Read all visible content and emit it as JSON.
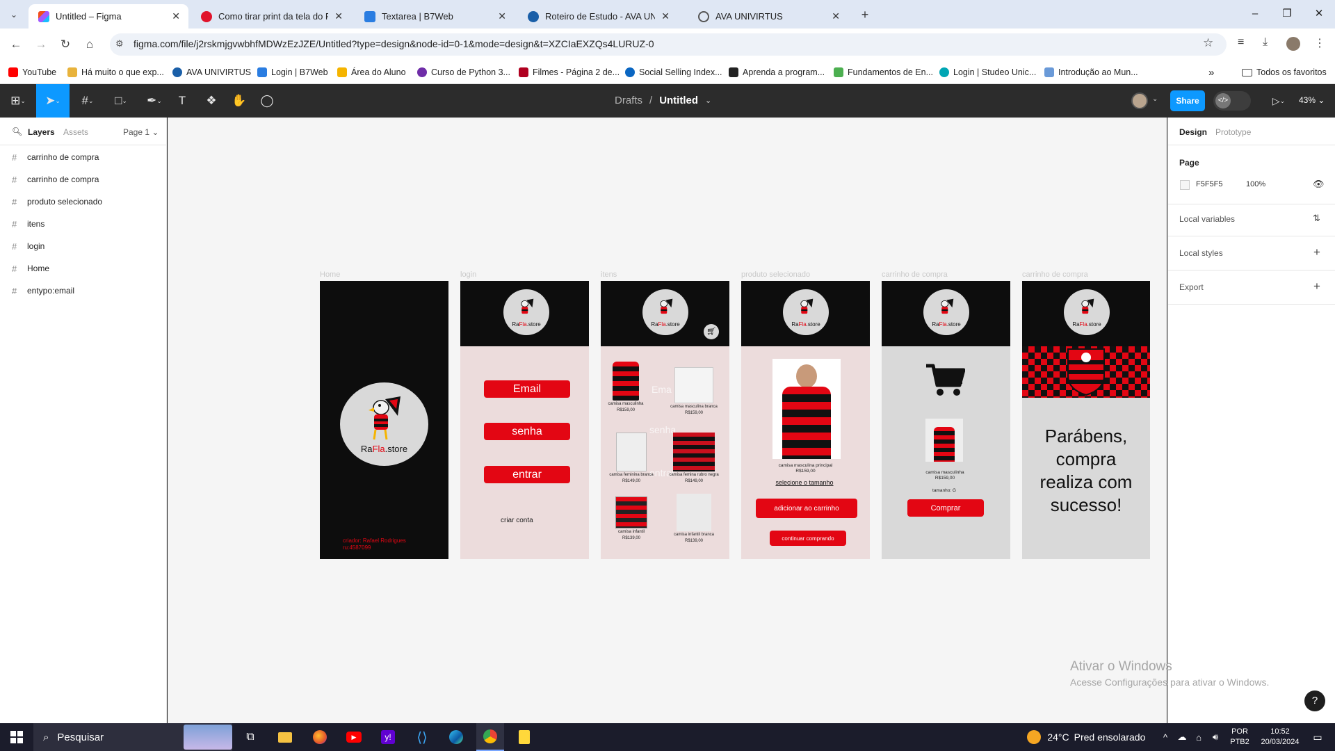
{
  "browser": {
    "tabs": [
      {
        "title": "Untitled – Figma",
        "active": true,
        "icon": "figma-icon"
      },
      {
        "title": "Como tirar print da tela do PC?",
        "active": false,
        "icon": "techtudo-icon"
      },
      {
        "title": "Textarea | B7Web",
        "active": false,
        "icon": "b7web-icon"
      },
      {
        "title": "Roteiro de Estudo - AVA UNIVIRTUS",
        "active": false,
        "icon": "univirtus-icon"
      },
      {
        "title": "AVA UNIVIRTUS",
        "active": false,
        "icon": "globe-icon"
      }
    ],
    "new_tab": "+",
    "url": "figma.com/file/j2rskmjgvwbhfMDWzEzJZE/Untitled?type=design&node-id=0-1&mode=design&t=XZCIaEXZQs4LURUZ-0",
    "bookmarks": [
      {
        "label": "YouTube",
        "color": "#ff0000"
      },
      {
        "label": "Há muito o que exp...",
        "color": "#e8b33c"
      },
      {
        "label": "AVA UNIVIRTUS",
        "color": "#1a5fa8"
      },
      {
        "label": "Login | B7Web",
        "color": "#2a7de1"
      },
      {
        "label": "Área do Aluno",
        "color": "#f5b400"
      },
      {
        "label": "Curso de Python 3...",
        "color": "#6f2da8"
      },
      {
        "label": "Filmes - Página 2 de...",
        "color": "#b00020"
      },
      {
        "label": "Social Selling Index...",
        "color": "#0a66c2"
      },
      {
        "label": "Aprenda a program...",
        "color": "#222222"
      },
      {
        "label": "Fundamentos de En...",
        "color": "#4caf50"
      },
      {
        "label": "Login | Studeo Unic...",
        "color": "#00a6b4"
      },
      {
        "label": "Introdução ao Mun...",
        "color": "#6a9ad8"
      }
    ],
    "favorites_label": "Todos os favoritos"
  },
  "figma": {
    "breadcrumb_drafts": "Drafts",
    "breadcrumb_sep": "/",
    "file_name": "Untitled",
    "share_label": "Share",
    "zoom": "43%",
    "left_tabs": {
      "layers": "Layers",
      "assets": "Assets",
      "page": "Page 1"
    },
    "layers": [
      "carrinho de compra",
      "carrinho de compra",
      "produto selecionado",
      "itens",
      "login",
      "Home",
      "entypo:email"
    ],
    "right_tabs": {
      "design": "Design",
      "prototype": "Prototype"
    },
    "page_section": {
      "title": "Page",
      "color_hex": "F5F5F5",
      "opacity": "100%"
    },
    "sections": [
      "Local variables",
      "Local styles",
      "Export"
    ],
    "accent": "#0d99ff"
  },
  "frames": {
    "labels": [
      "Home",
      "login",
      "itens",
      "produto selecionado",
      "carrinho de compra",
      "carrinho de compra"
    ],
    "logo_text_a": "Ra",
    "logo_text_b": "Fla",
    "logo_text_c": ".store",
    "home": {
      "creator": "criador: Rafael Rodrigues",
      "ru": "ru:4587099"
    },
    "login": {
      "email": "Email",
      "senha": "senha",
      "entrar": "entrar",
      "criar": "criar conta"
    },
    "itens": {
      "ghost_email": "Ema",
      "ghost_senha": "senha",
      "ghost_entrar": "entrar",
      "products": [
        {
          "name": "camisa masculinha",
          "price": "R$159,00"
        },
        {
          "name": "camisa masculina branca",
          "price": "R$159,00"
        },
        {
          "name": "camisa feminina branca",
          "price": "R$149,00"
        },
        {
          "name": "camisa femina rubro negra",
          "price": "R$149,00"
        },
        {
          "name": "camisa infantil",
          "price": "R$139,00"
        },
        {
          "name": "camisa infantil branca",
          "price": "R$139,00"
        }
      ]
    },
    "produto": {
      "name": "camisa masculina principal",
      "price": "R$159,00",
      "size": "selecione o tamanho",
      "add": "adicionar ao carrinho",
      "continue": "continuar comprando"
    },
    "carrinho": {
      "name": "camisa masculinha",
      "price": "R$159,00",
      "size": "tamanho: G",
      "buy": "Comprar"
    },
    "sucesso": {
      "message": "Parábens, compra realiza com sucesso!"
    }
  },
  "watermark": {
    "title": "Ativar o Windows",
    "sub": "Acesse Configurações para ativar o Windows."
  },
  "taskbar": {
    "search": "Pesquisar",
    "temp": "24°C",
    "weather": "Pred ensolarado",
    "lang1": "POR",
    "lang2": "PTB2",
    "time": "10:52",
    "date": "20/03/2024"
  },
  "colors": {
    "flamengo_red": "#e30613",
    "black": "#111111",
    "home_bg": "#0d0d0d",
    "pink_bg": "#ecdcdc",
    "gray_bg": "#d9d9d9"
  }
}
